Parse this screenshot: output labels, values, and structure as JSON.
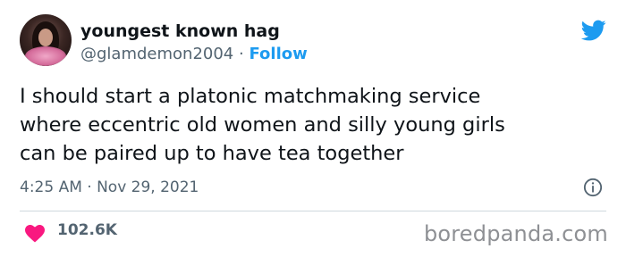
{
  "author": {
    "display_name": "youngest known hag",
    "handle": "@glamdemon2004",
    "separator": "·",
    "follow_label": "Follow"
  },
  "tweet": {
    "lines": [
      "I should start a platonic matchmaking service",
      "where eccentric old women and silly young girls",
      "can be paired up to have tea together"
    ],
    "timestamp": "4:25 AM · Nov 29, 2021"
  },
  "engagement": {
    "likes": "102.6K"
  },
  "icons": {
    "brand": "twitter-bird-icon",
    "info": "info-icon",
    "like": "heart-icon"
  },
  "colors": {
    "twitter_blue": "#1d9bf0",
    "heart_pink": "#f91880",
    "secondary_text": "#536471"
  },
  "watermark": "boredpanda.com"
}
